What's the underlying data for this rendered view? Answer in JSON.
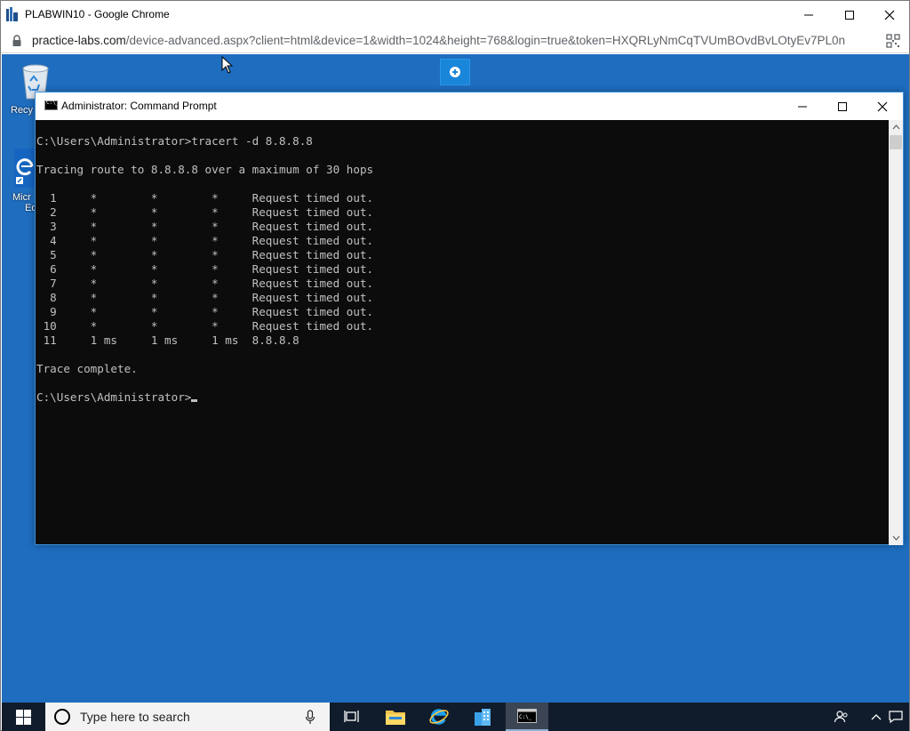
{
  "browser": {
    "title": "PLABWIN10 - Google Chrome",
    "url_host": "practice-labs.com",
    "url_path": "/device-advanced.aspx?client=html&device=1&width=1024&height=768&login=true&token=HXQRLyNmCqTVUmBOvdBvLOtyEv7PL0n"
  },
  "desktop": {
    "recycle_label": "Recy",
    "edge_label_1": "Micr",
    "edge_label_2": "Ed"
  },
  "cmd": {
    "title": "Administrator: Command Prompt",
    "prompt1": "C:\\Users\\Administrator>tracert -d 8.8.8.8",
    "tracing": "Tracing route to 8.8.8.8 over a maximum of 30 hops",
    "hops": [
      "  1     *        *        *     Request timed out.",
      "  2     *        *        *     Request timed out.",
      "  3     *        *        *     Request timed out.",
      "  4     *        *        *     Request timed out.",
      "  5     *        *        *     Request timed out.",
      "  6     *        *        *     Request timed out.",
      "  7     *        *        *     Request timed out.",
      "  8     *        *        *     Request timed out.",
      "  9     *        *        *     Request timed out.",
      " 10     *        *        *     Request timed out.",
      " 11     1 ms     1 ms     1 ms  8.8.8.8"
    ],
    "complete": "Trace complete.",
    "prompt2": "C:\\Users\\Administrator>"
  },
  "taskbar": {
    "search_placeholder": "Type here to search"
  },
  "colors": {
    "desktop_bg": "#1e6dbf",
    "taskbar_bg": "#101c2b",
    "console_bg": "#0c0c0c",
    "console_fg": "#c0c0c0"
  }
}
